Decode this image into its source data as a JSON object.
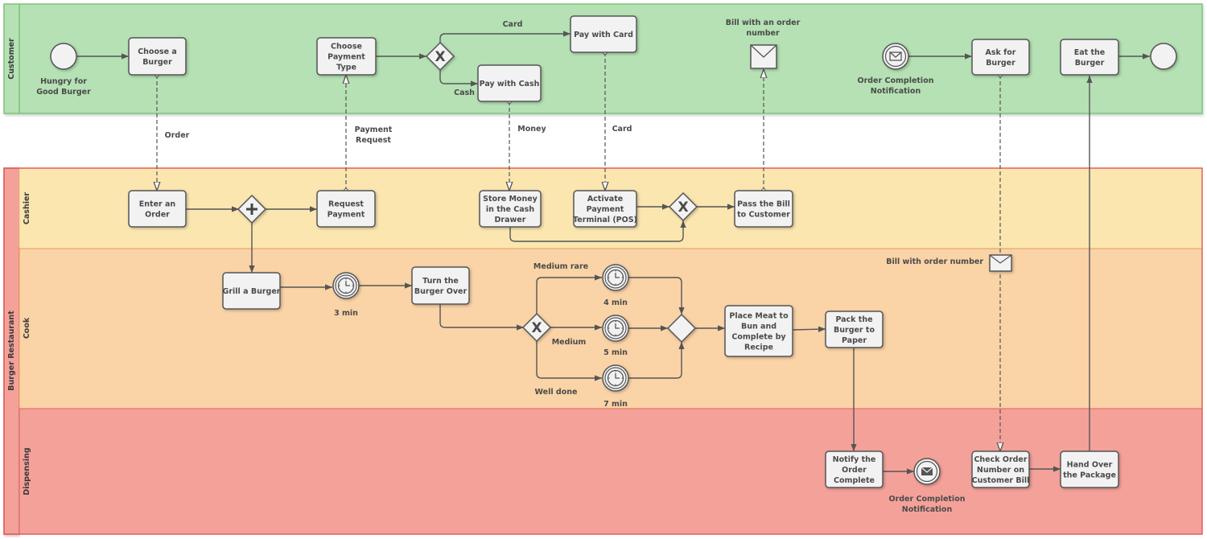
{
  "colors": {
    "customer_fill": "#b5e1b4",
    "customer_stroke": "#7cc47a",
    "cashier_fill": "#fbe6b0",
    "cook_fill": "#fad3a6",
    "dispensing_fill": "#f4a19a",
    "restaurant_stroke": "#e0605a",
    "shape_fill": "#f2f2f2",
    "line": "#555555"
  },
  "pools": {
    "customer": {
      "label": "Customer"
    },
    "restaurant": {
      "label": "Burger Restaurant",
      "lanes": [
        {
          "id": "cashier",
          "label": "Cashier"
        },
        {
          "id": "cook",
          "label": "Cook"
        },
        {
          "id": "dispensing",
          "label": "Dispensing"
        }
      ]
    }
  },
  "events": {
    "start": {
      "label": "Hungry for Good Burger",
      "lines": [
        "Hungry for",
        "Good Burger"
      ]
    },
    "end": {
      "label": ""
    },
    "order_notification_catch": {
      "lines": [
        "Order Completion",
        "Notification"
      ]
    },
    "order_notification_throw": {
      "lines": [
        "Order Completion",
        "Notification"
      ]
    },
    "timer_3": {
      "label": "3 min"
    },
    "timer_4": {
      "label": "4 min"
    },
    "timer_5": {
      "label": "5 min"
    },
    "timer_7": {
      "label": "7 min"
    }
  },
  "tasks": {
    "choose_burger": {
      "lines": [
        "Choose a",
        "Burger"
      ]
    },
    "choose_payment": {
      "lines": [
        "Choose",
        "Payment",
        "Type"
      ]
    },
    "pay_card": {
      "lines": [
        "Pay with Card"
      ]
    },
    "pay_cash": {
      "lines": [
        "Pay with Cash"
      ]
    },
    "ask_burger": {
      "lines": [
        "Ask for",
        "Burger"
      ]
    },
    "eat_burger": {
      "lines": [
        "Eat the",
        "Burger"
      ]
    },
    "enter_order": {
      "lines": [
        "Enter an",
        "Order"
      ]
    },
    "request_payment": {
      "lines": [
        "Request",
        "Payment"
      ]
    },
    "store_money": {
      "lines": [
        "Store Money",
        "in the Cash",
        "Drawer"
      ]
    },
    "activate_pos": {
      "lines": [
        "Activate",
        "Payment",
        "Terminal (POS)"
      ]
    },
    "pass_bill": {
      "lines": [
        "Pass the Bill",
        "to Customer"
      ]
    },
    "grill": {
      "lines": [
        "Grill a Burger"
      ]
    },
    "turn_over": {
      "lines": [
        "Turn the",
        "Burger Over"
      ]
    },
    "place_meat": {
      "lines": [
        "Place Meat to",
        "Bun and",
        "Complete by",
        "Recipe"
      ]
    },
    "pack": {
      "lines": [
        "Pack the",
        "Burger to",
        "Paper"
      ]
    },
    "notify": {
      "lines": [
        "Notify the",
        "Order",
        "Complete"
      ]
    },
    "check_order": {
      "lines": [
        "Check Order",
        "Number on",
        "Customer Bill"
      ]
    },
    "hand_over": {
      "lines": [
        "Hand Over",
        "the Package"
      ]
    }
  },
  "flow_labels": {
    "card": "Card",
    "cash": "Cash",
    "medium_rare": "Medium rare",
    "medium": "Medium",
    "well_done": "Well done"
  },
  "message_labels": {
    "order": "Order",
    "payment_request": [
      "Payment",
      "Request"
    ],
    "money": "Money",
    "card": "Card"
  },
  "data_objects": {
    "bill_customer": {
      "lines": [
        "Bill with an order",
        "number"
      ]
    },
    "bill_cook": {
      "label": "Bill with order number"
    }
  }
}
